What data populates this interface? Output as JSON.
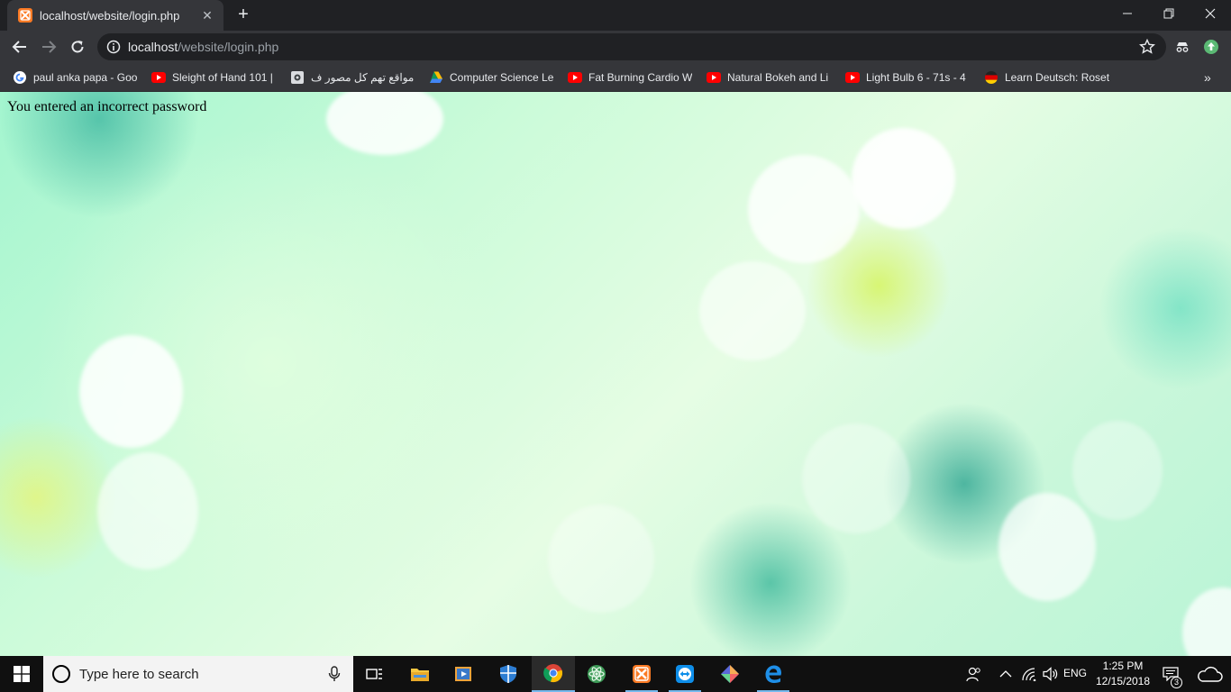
{
  "browser": {
    "tab": {
      "title": "localhost/website/login.php",
      "favicon": "xampp-icon"
    },
    "address_bar": {
      "host": "localhost",
      "path": "/website/login.php"
    },
    "bookmarks": [
      {
        "label": "paul anka papa - Goo",
        "icon": "google-icon"
      },
      {
        "label": "Sleight of Hand 101 |",
        "icon": "youtube-icon"
      },
      {
        "label": "مواقع تهم كل مصور ف",
        "icon": "camera-icon"
      },
      {
        "label": "Computer Science Le",
        "icon": "google-drive-icon"
      },
      {
        "label": "Fat Burning Cardio W",
        "icon": "youtube-icon"
      },
      {
        "label": "Natural Bokeh and Li",
        "icon": "youtube-icon"
      },
      {
        "label": "Light Bulb 6 - 71s - 4",
        "icon": "youtube-icon"
      },
      {
        "label": "Learn Deutsch: Roset",
        "icon": "german-flag-icon"
      }
    ]
  },
  "page": {
    "message": "You entered an incorrect password"
  },
  "taskbar": {
    "search_placeholder": "Type here to search",
    "language": "ENG",
    "time": "1:25 PM",
    "date": "12/15/2018",
    "notification_count": "3"
  },
  "colors": {
    "tab_active": "#35363a",
    "titlebar": "#202124",
    "taskbar": "#101010",
    "accent": "#76b9ed"
  }
}
